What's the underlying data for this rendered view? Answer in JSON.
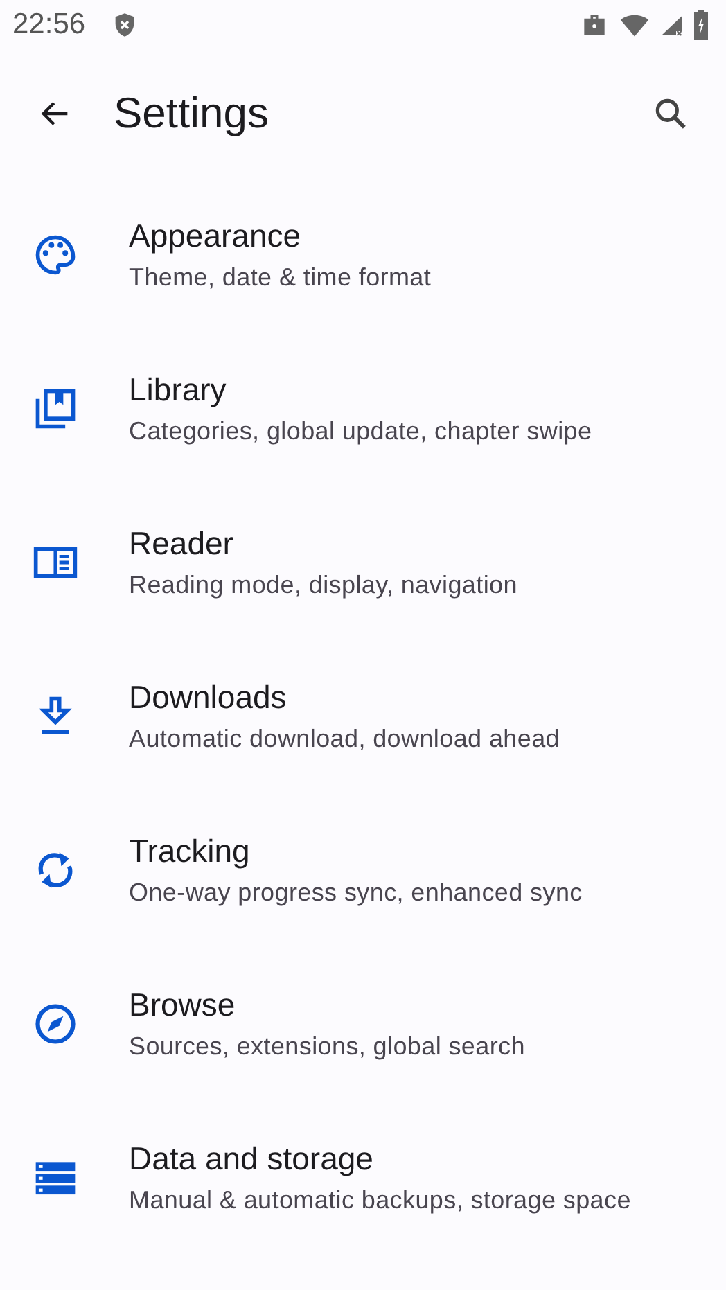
{
  "status_bar": {
    "time": "22:56"
  },
  "toolbar": {
    "title": "Settings"
  },
  "items": [
    {
      "title": "Appearance",
      "subtitle": "Theme, date & time format"
    },
    {
      "title": "Library",
      "subtitle": "Categories, global update, chapter swipe"
    },
    {
      "title": "Reader",
      "subtitle": "Reading mode, display, navigation"
    },
    {
      "title": "Downloads",
      "subtitle": "Automatic download, download ahead"
    },
    {
      "title": "Tracking",
      "subtitle": "One-way progress sync, enhanced sync"
    },
    {
      "title": "Browse",
      "subtitle": "Sources, extensions, global search"
    },
    {
      "title": "Data and storage",
      "subtitle": "Manual & automatic backups, storage space"
    }
  ]
}
